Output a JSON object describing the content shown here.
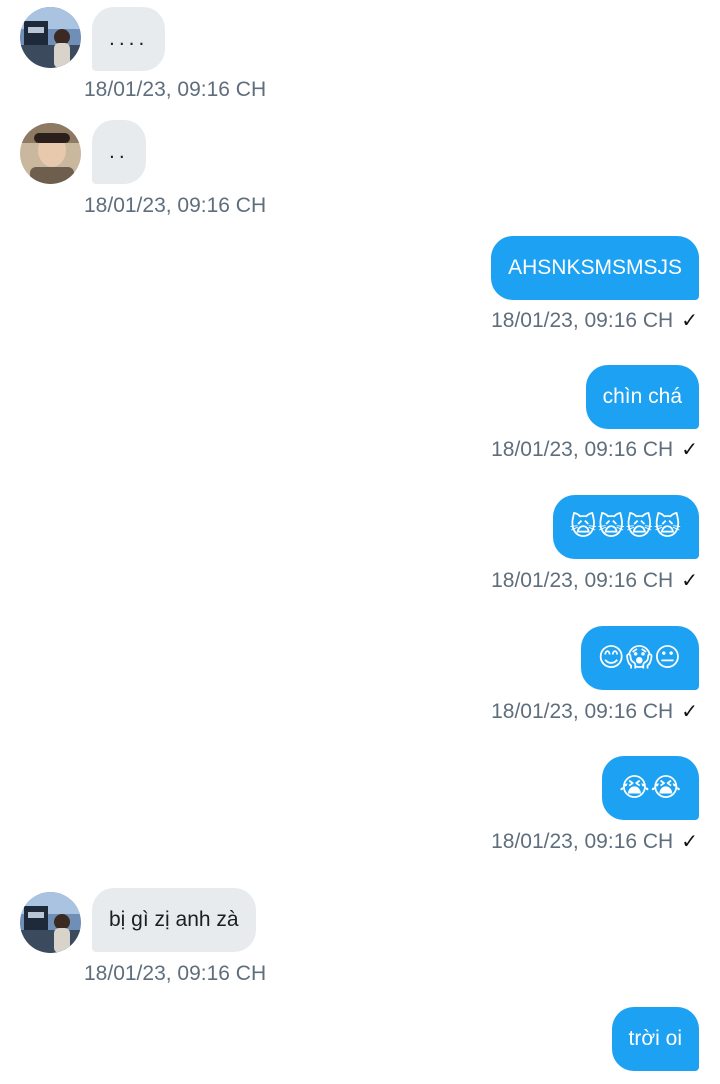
{
  "messages": [
    {
      "dir": "in",
      "text": "....",
      "time": "18/01/23,  09:16 CH",
      "avatar": "avatar-a"
    },
    {
      "dir": "in",
      "text": "..",
      "time": "18/01/23,  09:16 CH",
      "avatar": "avatar-b"
    },
    {
      "dir": "out",
      "text": "AHSNKSMSMSJS",
      "time": "18/01/23,  09:16 CH",
      "check": "✓"
    },
    {
      "dir": "out",
      "text": "chìn chá",
      "time": "18/01/23,  09:16 CH",
      "check": "✓"
    },
    {
      "dir": "out",
      "text": "🙀🙀🙀🙀",
      "time": "18/01/23,  09:16 CH",
      "check": "✓"
    },
    {
      "dir": "out",
      "text": "😊😱😐",
      "time": "18/01/23,  09:16 CH",
      "check": "✓"
    },
    {
      "dir": "out",
      "text": "😭😭",
      "time": "18/01/23,  09:16 CH",
      "check": "✓"
    },
    {
      "dir": "in",
      "text": "bị gì zị anh zà",
      "time": "18/01/23,  09:16 CH",
      "avatar": "avatar-a"
    },
    {
      "dir": "out",
      "text": "trời oi"
    }
  ],
  "colors": {
    "incoming_bubble": "#e8ebee",
    "outgoing_bubble": "#1da1f2",
    "timestamp": "#5f6e7c"
  },
  "icons": {
    "read": "check-icon"
  }
}
